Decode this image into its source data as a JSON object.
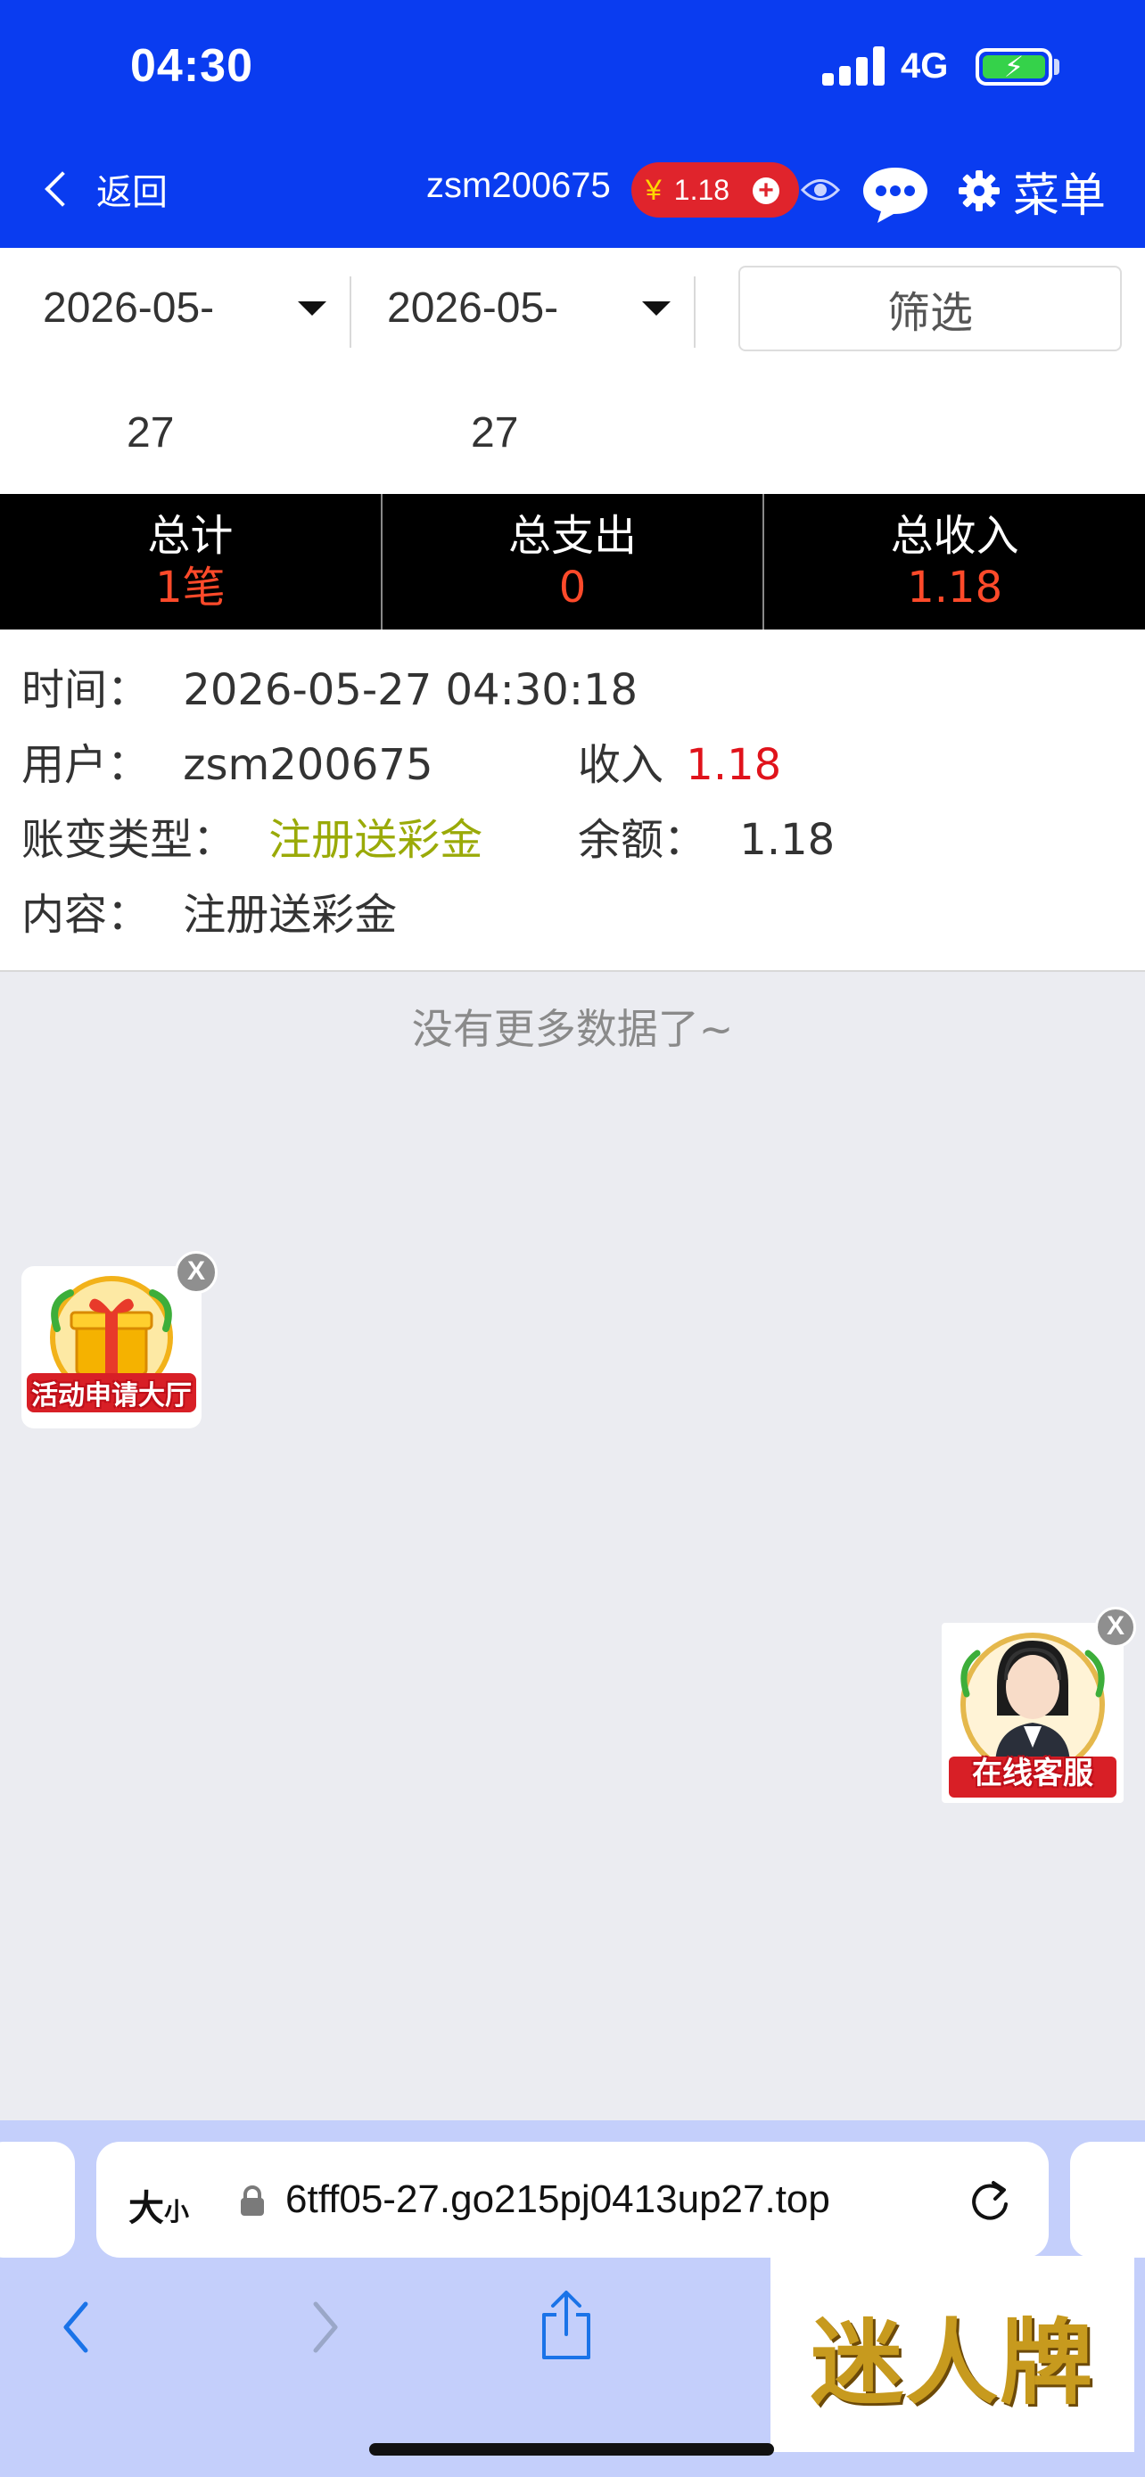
{
  "status_bar": {
    "time": "04:30",
    "network": "4G"
  },
  "nav": {
    "back_label": "返回",
    "username": "zsm200675",
    "balance_currency": "¥",
    "balance": "1.18",
    "menu_label": "菜单"
  },
  "filter": {
    "start_date": "2026-05-",
    "start_day": "27",
    "end_date": "2026-05-",
    "end_day": "27",
    "filter_button": "筛选"
  },
  "summary": [
    {
      "label": "总计",
      "value": "1笔"
    },
    {
      "label": "总支出",
      "value": "0"
    },
    {
      "label": "总收入",
      "value": "1.18"
    }
  ],
  "record": {
    "time_label": "时间：",
    "time_value": "2026-05-27 04:30:18",
    "user_label": "用户：",
    "user_value": "zsm200675",
    "income_label": "收入",
    "income_value": "1.18",
    "type_label": "账变类型：",
    "type_value": "注册送彩金",
    "balance_label": "余额：",
    "balance_value": "1.18",
    "content_label": "内容：",
    "content_value": "注册送彩金"
  },
  "no_more": "没有更多数据了~",
  "floating": {
    "activity_caption": "活动申请大厅",
    "service_caption": "在线客服",
    "close": "X"
  },
  "browser": {
    "text_size": "大",
    "text_size_small": "小",
    "url": "6tff05-27.go215pj0413up27.top",
    "brand": "迷人牌"
  },
  "colors": {
    "header_blue": "#0a3cf0",
    "accent_red": "#e0131b",
    "summary_red": "#ff4a2a",
    "type_olive": "#9aaa08"
  }
}
